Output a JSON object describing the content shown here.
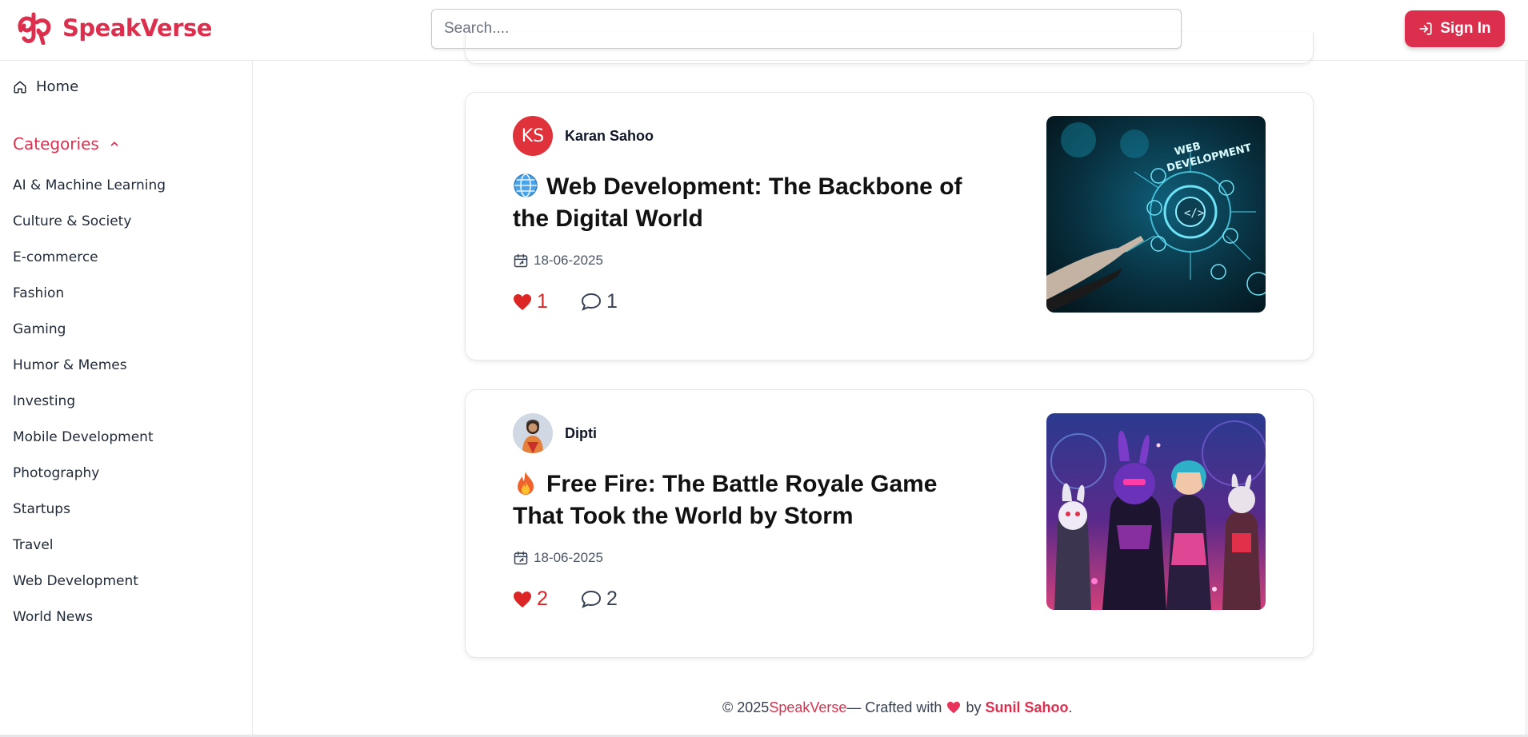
{
  "header": {
    "brand": "SpeakVerse",
    "search_placeholder": "Search....",
    "signin_label": "Sign In"
  },
  "sidebar": {
    "home_label": "Home",
    "categories_label": "Categories",
    "categories": [
      "AI & Machine Learning",
      "Culture & Society",
      "E-commerce",
      "Fashion",
      "Gaming",
      "Humor & Memes",
      "Investing",
      "Mobile Development",
      "Photography",
      "Startups",
      "Travel",
      "Web Development",
      "World News"
    ]
  },
  "posts": [
    {
      "author_initials": "KS",
      "author_name": "Karan Sahoo",
      "emoji_icon": "globe-icon",
      "title": "Web Development: The Backbone of the Digital World",
      "date": "18-06-2025",
      "likes": "1",
      "comments": "1",
      "thumb_text": "WEB DEVELOPMENT"
    },
    {
      "author_name": "Dipti",
      "emoji_icon": "fire-icon",
      "title": "Free Fire: The Battle Royale Game That Took the World by Storm",
      "date": "18-06-2025",
      "likes": "2",
      "comments": "2"
    }
  ],
  "footer": {
    "copyright": "© 2025",
    "brand": "SpeakVerse",
    "crafted": "— Crafted with",
    "by": "by",
    "creator": "Sunil Sahoo",
    "period": "."
  },
  "colors": {
    "accent": "#dc2f4d",
    "like": "#dc2626"
  }
}
